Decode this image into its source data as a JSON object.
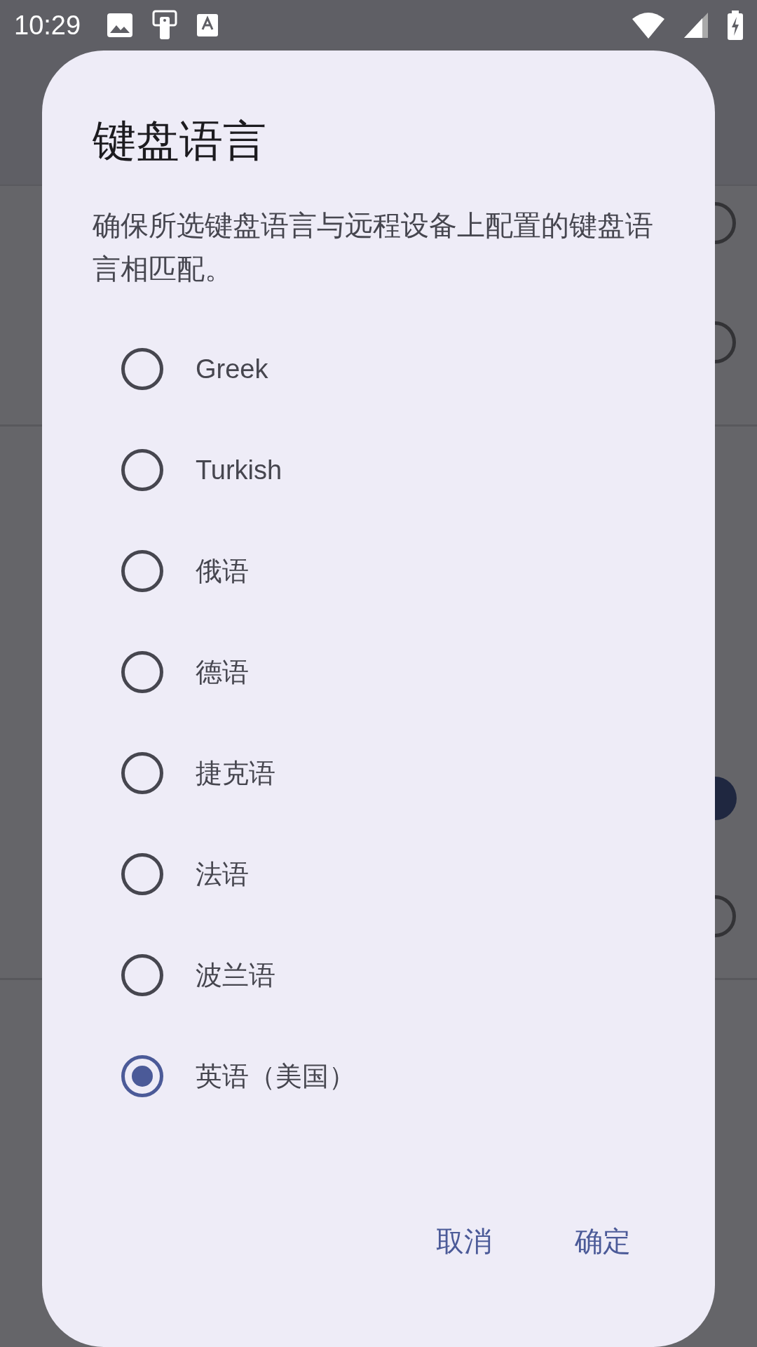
{
  "status_bar": {
    "time": "10:29"
  },
  "background": {
    "toggles": [
      {
        "selected": false
      },
      {
        "selected": false
      },
      {
        "selected": true
      },
      {
        "selected": false
      }
    ]
  },
  "dialog": {
    "title": "键盘语言",
    "message": "确保所选键盘语言与远程设备上配置的键盘语言相匹配。",
    "options": [
      {
        "label": "Greek",
        "selected": false
      },
      {
        "label": "Turkish",
        "selected": false
      },
      {
        "label": "俄语",
        "selected": false
      },
      {
        "label": "德语",
        "selected": false
      },
      {
        "label": "捷克语",
        "selected": false
      },
      {
        "label": "法语",
        "selected": false
      },
      {
        "label": "波兰语",
        "selected": false
      },
      {
        "label": "英语（美国）",
        "selected": true
      }
    ],
    "buttons": [
      "取消",
      "确定"
    ]
  }
}
